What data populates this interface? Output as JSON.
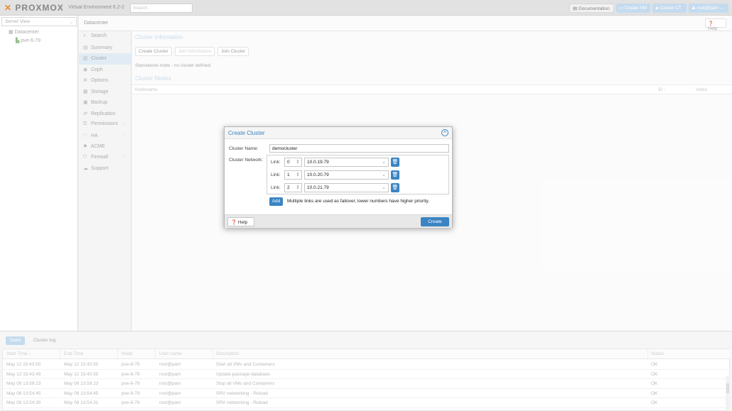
{
  "topbar": {
    "logo": "PROXMOX",
    "version": "Virtual Environment 6.2-2",
    "search_placeholder": "Search",
    "documentation": "Documentation",
    "create_vm": "Create VM",
    "create_ct": "Create CT",
    "user": "root@pam"
  },
  "sidebar": {
    "view": "Server View",
    "tree": [
      {
        "label": "Datacenter"
      },
      {
        "label": "pve-6-79"
      }
    ]
  },
  "header": {
    "title": "Datacenter",
    "help": "Help"
  },
  "nav": {
    "items": [
      {
        "label": "Search",
        "icon": "search-icon"
      },
      {
        "label": "Summary",
        "icon": "book-icon"
      },
      {
        "label": "Cluster",
        "icon": "server-icon"
      },
      {
        "label": "Ceph",
        "icon": "ceph-icon"
      },
      {
        "label": "Options",
        "icon": "gear-icon"
      },
      {
        "label": "Storage",
        "icon": "database-icon"
      },
      {
        "label": "Backup",
        "icon": "floppy-icon"
      },
      {
        "label": "Replication",
        "icon": "retweet-icon"
      },
      {
        "label": "Permissions",
        "icon": "unlock-icon"
      },
      {
        "label": "HA",
        "icon": "heartbeat-icon"
      },
      {
        "label": "ACME",
        "icon": "certificate-icon"
      },
      {
        "label": "Firewall",
        "icon": "shield-icon"
      },
      {
        "label": "Support",
        "icon": "comments-icon"
      }
    ],
    "selected": "Cluster"
  },
  "cluster": {
    "info_title": "Cluster Information",
    "btn_create": "Create Cluster",
    "btn_join_info": "Join Information",
    "btn_join": "Join Cluster",
    "standalone": "Standalone node - no cluster defined",
    "nodes_title": "Cluster Nodes",
    "col_nodename": "Nodename",
    "col_id": "ID ↑",
    "col_votes": "Votes"
  },
  "dialog": {
    "title": "Create Cluster",
    "name_label": "Cluster Name:",
    "name_value": "democluster",
    "network_label": "Cluster Network:",
    "links": [
      {
        "label": "Link:",
        "num": "0",
        "addr": "10.0.19.79"
      },
      {
        "label": "Link:",
        "num": "1",
        "addr": "10.0.20.79"
      },
      {
        "label": "Link:",
        "num": "2",
        "addr": "10.0.21.79"
      }
    ],
    "add": "Add",
    "add_note": "Multiple links are used as failover, lower numbers have higher priority.",
    "help": "Help",
    "create": "Create"
  },
  "tasks": {
    "tab_tasks": "Tasks",
    "tab_log": "Cluster log",
    "columns": [
      "Start Time ↓",
      "End Time",
      "Node",
      "User name",
      "Description",
      "Status"
    ],
    "rows": [
      [
        "May 12 15:43:50",
        "May 12 15:43:50",
        "pve-6-79",
        "root@pam",
        "Start all VMs and Containers",
        "OK"
      ],
      [
        "May 12 15:43:49",
        "May 12 15:43:55",
        "pve-6-79",
        "root@pam",
        "Update package database",
        "OK"
      ],
      [
        "May 08 13:59:23",
        "May 08 13:59:23",
        "pve-6-79",
        "root@pam",
        "Stop all VMs and Containers",
        "OK"
      ],
      [
        "May 08 13:54:45",
        "May 08 13:54:45",
        "pve-6-79",
        "root@pam",
        "SRV networking - Reload",
        "OK"
      ],
      [
        "May 08 13:54:30",
        "May 08 13:54:31",
        "pve-6-79",
        "root@pam",
        "SRV networking - Reload",
        "OK"
      ]
    ]
  },
  "colors": {
    "accent": "#3a84c3",
    "brand_x": "#e57000"
  }
}
